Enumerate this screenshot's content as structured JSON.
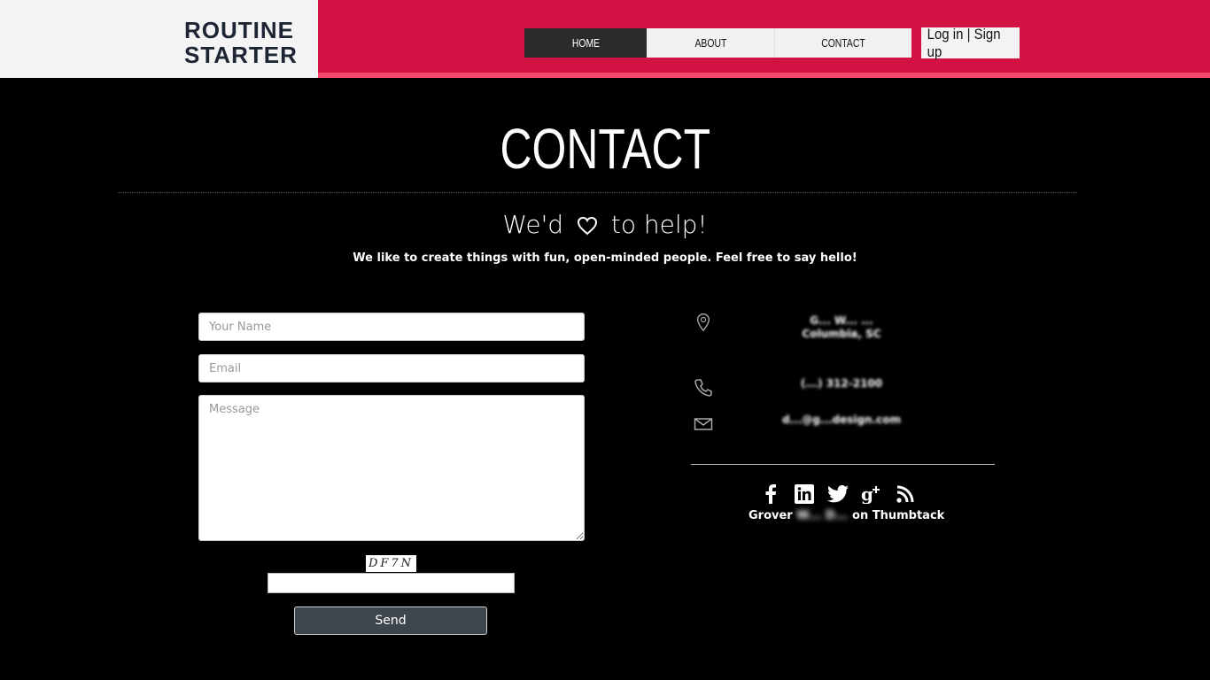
{
  "header": {
    "logo_line1": "ROUTINE",
    "logo_line2": "STARTER",
    "nav": [
      "HOME",
      "ABOUT",
      "CONTACT"
    ],
    "login": "Log in | Sign up"
  },
  "colors": {
    "brand_red": "#d31244",
    "brand_pink": "#f24a6f",
    "logo_navy": "#1d2433",
    "background": "#000000"
  },
  "main": {
    "title": "CONTACT",
    "subheading_left": "We'd",
    "subheading_right": "to help!",
    "tagline": "We like to create things with fun, open-minded people. Feel free to say hello!"
  },
  "form": {
    "name_placeholder": "Your Name",
    "email_placeholder": "Email",
    "message_placeholder": "Message",
    "captcha_text": "DF7N",
    "send_label": "Send"
  },
  "contact": {
    "address_line1": "G... W... ...",
    "address_line2": "Columbia, SC",
    "phone": "(...) 312-2100",
    "email": "d...@g...design.com",
    "icons": [
      "location-icon",
      "phone-icon",
      "mail-icon"
    ]
  },
  "social": {
    "icons": [
      "facebook-icon",
      "linkedin-icon",
      "twitter-icon",
      "google-plus-icon",
      "rss-icon"
    ],
    "thumbtack_left": "Grover",
    "thumbtack_blur": "W... D...",
    "thumbtack_right": "on Thumbtack"
  }
}
